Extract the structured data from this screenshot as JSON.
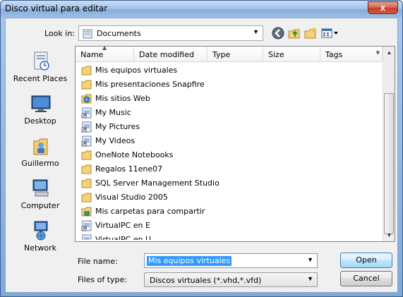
{
  "window": {
    "title": "Disco virtual para editar",
    "close_label": "x"
  },
  "lookin": {
    "label": "Look in:",
    "value": "Documents"
  },
  "toolbar": {
    "icons": [
      "back-icon",
      "up-folder-icon",
      "new-folder-icon",
      "views-icon"
    ]
  },
  "places": [
    {
      "label": "Recent Places",
      "icon": "recent-places-icon"
    },
    {
      "label": "Desktop",
      "icon": "desktop-icon"
    },
    {
      "label": "Guillermo",
      "icon": "user-folder-icon"
    },
    {
      "label": "Computer",
      "icon": "computer-icon"
    },
    {
      "label": "Network",
      "icon": "network-icon"
    }
  ],
  "columns": [
    "Name",
    "Date modified",
    "Type",
    "Size",
    "Tags"
  ],
  "files": [
    {
      "name": "Mis equipos virtuales",
      "icon": "folder-icon"
    },
    {
      "name": "Mis presentaciones Snapfire",
      "icon": "folder-icon"
    },
    {
      "name": "Mis sitios Web",
      "icon": "web-folder-icon"
    },
    {
      "name": "My Music",
      "icon": "shortcut-icon"
    },
    {
      "name": "My Pictures",
      "icon": "shortcut-icon"
    },
    {
      "name": "My Videos",
      "icon": "shortcut-icon"
    },
    {
      "name": "OneNote Notebooks",
      "icon": "folder-icon"
    },
    {
      "name": "Regalos 11ene07",
      "icon": "folder-icon"
    },
    {
      "name": "SQL Server Management Studio",
      "icon": "folder-icon"
    },
    {
      "name": "Visual Studio 2005",
      "icon": "folder-icon"
    },
    {
      "name": "Mis carpetas para compartir",
      "icon": "shared-folder-icon"
    },
    {
      "name": "VirtualPC en E",
      "icon": "shortcut-icon"
    },
    {
      "name": "VirtualPC en U",
      "icon": "shortcut-icon"
    }
  ],
  "filename": {
    "label": "File name:",
    "value": "Mis equipos virtuales"
  },
  "filetype": {
    "label": "Files of type:",
    "value": "Discos virtuales (*.vhd,*.vfd)"
  },
  "buttons": {
    "open": "Open",
    "cancel": "Cancel"
  }
}
